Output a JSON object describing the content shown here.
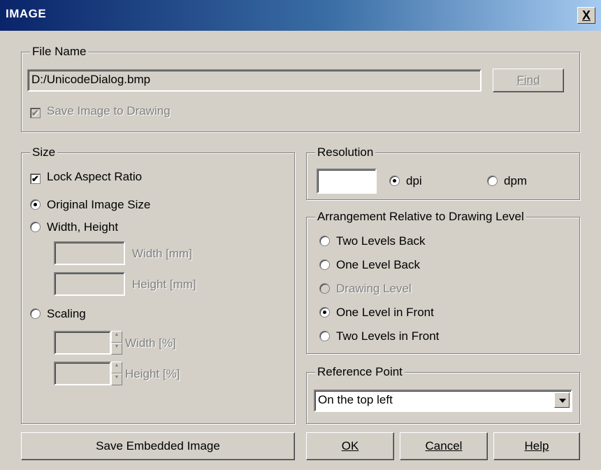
{
  "window": {
    "title": "IMAGE",
    "close_label": "X"
  },
  "file_name": {
    "legend": "File Name",
    "path": "D:/UnicodeDialog.bmp",
    "find_label": "Find",
    "save_to_drawing_label": "Save Image to Drawing",
    "save_to_drawing_checked": true,
    "save_to_drawing_enabled": false
  },
  "size": {
    "legend": "Size",
    "lock_aspect_label": "Lock Aspect Ratio",
    "lock_aspect_checked": true,
    "options": {
      "original": "Original Image Size",
      "width_height": "Width, Height",
      "scaling": "Scaling"
    },
    "selected_option": "original",
    "width_mm_label": "Width [mm]",
    "height_mm_label": "Height [mm]",
    "width_pct_label": "Width [%]",
    "height_pct_label": "Height [%]"
  },
  "resolution": {
    "legend": "Resolution",
    "value": "",
    "dpi_label": "dpi",
    "dpm_label": "dpm",
    "selected": "dpi"
  },
  "arrangement": {
    "legend": "Arrangement Relative to Drawing Level",
    "options": [
      {
        "label": "Two Levels Back",
        "selected": false,
        "enabled": true
      },
      {
        "label": "One Level Back",
        "selected": false,
        "enabled": true
      },
      {
        "label": "Drawing Level",
        "selected": false,
        "enabled": false
      },
      {
        "label": "One Level in Front",
        "selected": true,
        "enabled": true
      },
      {
        "label": "Two Levels in Front",
        "selected": false,
        "enabled": true
      }
    ]
  },
  "reference_point": {
    "legend": "Reference Point",
    "selected": "On the top left"
  },
  "buttons": {
    "save_embedded": "Save Embedded Image",
    "ok": "OK",
    "cancel": "Cancel",
    "help": "Help"
  },
  "colors": {
    "dialog_face": "#d4d0c8",
    "title_gradient_start": "#0a246a",
    "title_gradient_end": "#a6caf0",
    "disabled_text": "#808080"
  }
}
